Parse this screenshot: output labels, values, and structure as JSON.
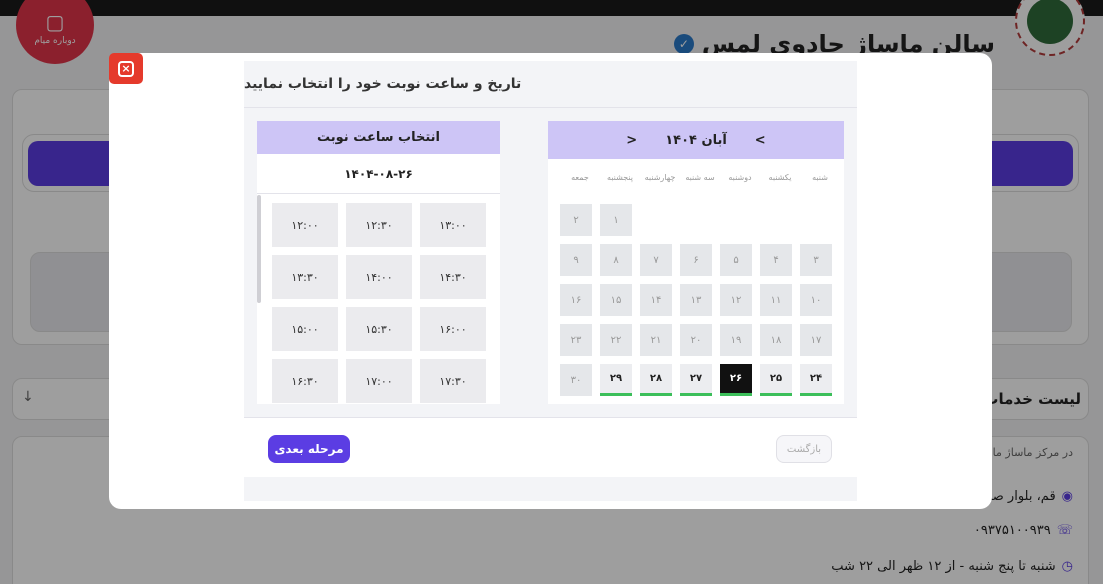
{
  "background": {
    "logo_text": "دوباره میام",
    "salon_title": "سالن ماساژ جادوی لمس",
    "services_title": "لیست خدمات",
    "intro_snippet": "در مرکز ماساژ ما، با",
    "address": "قم، بلوار صد",
    "phone": "۰۹۳۷۵۱۰۰۹۳۹",
    "hours": "شنبه تا پنج شنبه - از ۱۲ ظهر الی ۲۲ شب"
  },
  "modal": {
    "title": "تاریخ و ساعت نوبت خود را انتخاب نمایید",
    "calendar": {
      "month_label": "آبان ۱۴۰۴",
      "prev_label": "<",
      "next_label": ">",
      "weekdays": [
        "شنبه",
        "یکشنبه",
        "دوشنبه",
        "سه شنبه",
        "چهارشنبه",
        "پنجشنبه",
        "جمعه"
      ],
      "days": [
        {
          "label": "۱",
          "col": 5,
          "row": 0,
          "state": "disabled"
        },
        {
          "label": "۲",
          "col": 6,
          "row": 0,
          "state": "disabled"
        },
        {
          "label": "۳",
          "col": 0,
          "row": 1,
          "state": "disabled"
        },
        {
          "label": "۴",
          "col": 1,
          "row": 1,
          "state": "disabled"
        },
        {
          "label": "۵",
          "col": 2,
          "row": 1,
          "state": "disabled"
        },
        {
          "label": "۶",
          "col": 3,
          "row": 1,
          "state": "disabled"
        },
        {
          "label": "۷",
          "col": 4,
          "row": 1,
          "state": "disabled"
        },
        {
          "label": "۸",
          "col": 5,
          "row": 1,
          "state": "disabled"
        },
        {
          "label": "۹",
          "col": 6,
          "row": 1,
          "state": "disabled"
        },
        {
          "label": "۱۰",
          "col": 0,
          "row": 2,
          "state": "disabled"
        },
        {
          "label": "۱۱",
          "col": 1,
          "row": 2,
          "state": "disabled"
        },
        {
          "label": "۱۲",
          "col": 2,
          "row": 2,
          "state": "disabled"
        },
        {
          "label": "۱۳",
          "col": 3,
          "row": 2,
          "state": "disabled"
        },
        {
          "label": "۱۴",
          "col": 4,
          "row": 2,
          "state": "disabled"
        },
        {
          "label": "۱۵",
          "col": 5,
          "row": 2,
          "state": "disabled"
        },
        {
          "label": "۱۶",
          "col": 6,
          "row": 2,
          "state": "disabled"
        },
        {
          "label": "۱۷",
          "col": 0,
          "row": 3,
          "state": "disabled"
        },
        {
          "label": "۱۸",
          "col": 1,
          "row": 3,
          "state": "disabled"
        },
        {
          "label": "۱۹",
          "col": 2,
          "row": 3,
          "state": "disabled"
        },
        {
          "label": "۲۰",
          "col": 3,
          "row": 3,
          "state": "disabled"
        },
        {
          "label": "۲۱",
          "col": 4,
          "row": 3,
          "state": "disabled"
        },
        {
          "label": "۲۲",
          "col": 5,
          "row": 3,
          "state": "disabled"
        },
        {
          "label": "۲۳",
          "col": 6,
          "row": 3,
          "state": "disabled"
        },
        {
          "label": "۲۴",
          "col": 0,
          "row": 4,
          "state": "active"
        },
        {
          "label": "۲۵",
          "col": 1,
          "row": 4,
          "state": "active"
        },
        {
          "label": "۲۶",
          "col": 2,
          "row": 4,
          "state": "selected"
        },
        {
          "label": "۲۷",
          "col": 3,
          "row": 4,
          "state": "active"
        },
        {
          "label": "۲۸",
          "col": 4,
          "row": 4,
          "state": "active"
        },
        {
          "label": "۲۹",
          "col": 5,
          "row": 4,
          "state": "active"
        },
        {
          "label": "۳۰",
          "col": 6,
          "row": 4,
          "state": "disabled"
        }
      ]
    },
    "time": {
      "title": "انتخاب ساعت نوبت",
      "selected_date": "۱۴۰۴-۰۸-۲۶",
      "slots": [
        {
          "label": "۱۳:۰۰",
          "col": 0,
          "row": 0
        },
        {
          "label": "۱۲:۳۰",
          "col": 1,
          "row": 0
        },
        {
          "label": "۱۲:۰۰",
          "col": 2,
          "row": 0
        },
        {
          "label": "۱۴:۳۰",
          "col": 0,
          "row": 1
        },
        {
          "label": "۱۴:۰۰",
          "col": 1,
          "row": 1
        },
        {
          "label": "۱۳:۳۰",
          "col": 2,
          "row": 1
        },
        {
          "label": "۱۶:۰۰",
          "col": 0,
          "row": 2
        },
        {
          "label": "۱۵:۳۰",
          "col": 1,
          "row": 2
        },
        {
          "label": "۱۵:۰۰",
          "col": 2,
          "row": 2
        },
        {
          "label": "۱۷:۳۰",
          "col": 0,
          "row": 3
        },
        {
          "label": "۱۷:۰۰",
          "col": 1,
          "row": 3
        },
        {
          "label": "۱۶:۳۰",
          "col": 2,
          "row": 3
        }
      ]
    },
    "buttons": {
      "next": "مرحله بعدی",
      "back": "بازگشت"
    },
    "colors": {
      "accent": "#5b3de3",
      "header_bg": "#cdc5f6",
      "available_indicator": "#3cbf5a",
      "close_button": "#e53a2c"
    }
  }
}
